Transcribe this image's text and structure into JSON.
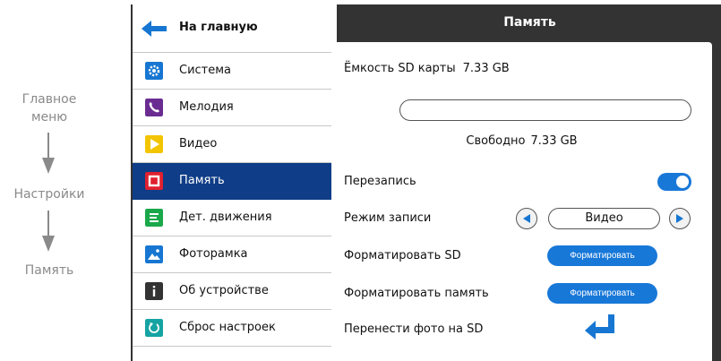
{
  "breadcrumb": {
    "step1": "Главное\nменю",
    "step2": "Настройки",
    "step3": "Память"
  },
  "sidebar": {
    "back_label": "На главную",
    "items": [
      {
        "label": "Система",
        "icon": "gear-icon",
        "color": "#1676d2"
      },
      {
        "label": "Мелодия",
        "icon": "phone-icon",
        "color": "#6a2c91"
      },
      {
        "label": "Видео",
        "icon": "play-icon",
        "color": "#f2c500"
      },
      {
        "label": "Память",
        "icon": "memory-icon",
        "color": "#e02030",
        "active": true
      },
      {
        "label": "Дет. движения",
        "icon": "motion-icon",
        "color": "#1aa84a"
      },
      {
        "label": "Фоторамка",
        "icon": "photo-icon",
        "color": "#1676d2"
      },
      {
        "label": "Об устройстве",
        "icon": "info-icon",
        "color": "#333333"
      },
      {
        "label": "Сброс настроек",
        "icon": "reset-icon",
        "color": "#16a3a3"
      }
    ]
  },
  "page": {
    "title": "Память",
    "sd_capacity_label": "Ёмкость SD карты",
    "sd_capacity_value": "7.33 GB",
    "sd_usage_fraction": 0,
    "free_label": "Свободно",
    "free_value": "7.33 GB",
    "overwrite_label": "Перезапись",
    "overwrite_on": true,
    "record_mode_label": "Режим записи",
    "record_mode_value": "Видео",
    "format_sd_label": "Форматировать SD",
    "format_sd_button": "Форматировать",
    "format_memory_label": "Форматировать память",
    "format_memory_button": "Форматировать",
    "move_photos_label": "Перенести фото на SD"
  },
  "colors": {
    "accent": "#1878d8",
    "active_item": "#0f3d87",
    "header_bg": "#333333"
  }
}
